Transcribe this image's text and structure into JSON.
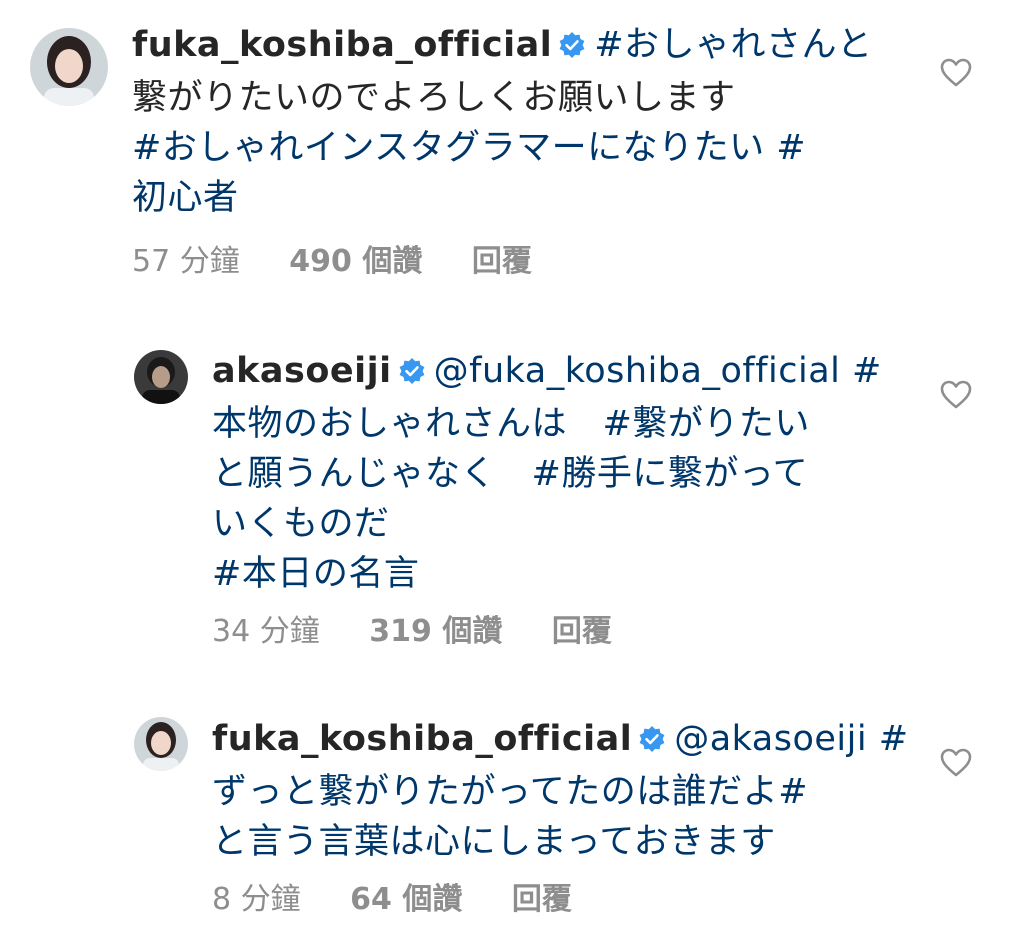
{
  "comments": [
    {
      "username": "fuka_koshiba_official",
      "lines": [
        "#おしゃれさんと",
        "繋がりたいのでよろしくお願いします",
        "#おしゃれインスタグラマーになりたい #",
        "初心者"
      ],
      "time": "57 分鐘",
      "likes": "490 個讚",
      "reply": "回覆"
    },
    {
      "username": "akasoeiji",
      "lines": [
        "@fuka_koshiba_official #",
        "本物のおしゃれさんは　#繋がりたい",
        "と願うんじゃなく　#勝手に繋がって",
        "いくものだ",
        "#本日の名言"
      ],
      "time": "34 分鐘",
      "likes": "319 個讚",
      "reply": "回覆"
    },
    {
      "username": "fuka_koshiba_official",
      "lines": [
        "@akasoeiji #",
        "ずっと繋がりたがってたのは誰だよ#",
        "と言う言葉は心にしまっておきます"
      ],
      "time": "8 分鐘",
      "likes": "64 個讚",
      "reply": "回覆"
    }
  ],
  "icons": {
    "verified": "verified-badge-icon",
    "like": "heart-outline-icon"
  },
  "colors": {
    "text": "#262626",
    "hashtag": "#00376b",
    "meta": "#8e8e8e",
    "verified": "#3897f0"
  }
}
